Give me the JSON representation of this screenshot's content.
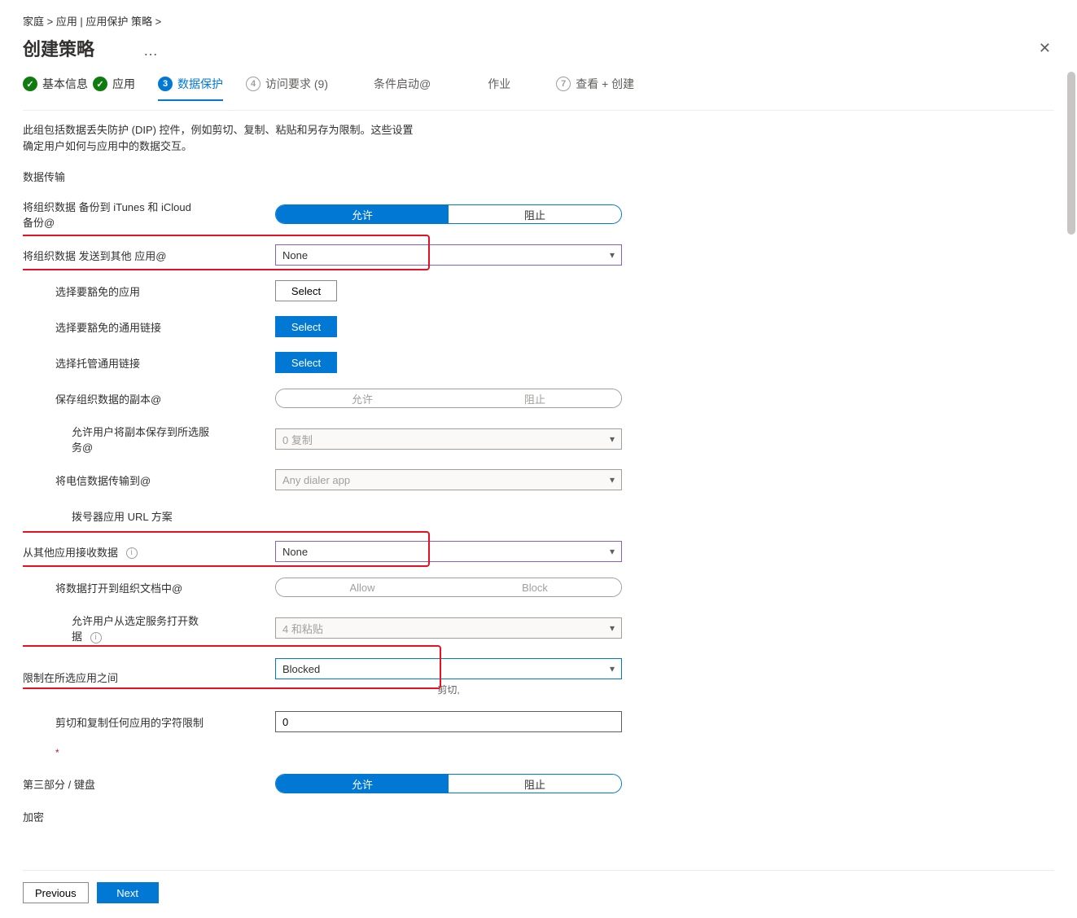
{
  "breadcrumb": "家庭 >   应用 | 应用保护 策略 >",
  "pageTitle": "创建策略",
  "ellipsis": "…",
  "steps": {
    "s1": "基本信息",
    "s2": "应用",
    "s3": "数据保护",
    "s4": "访问要求 (9)",
    "s4num": "4",
    "s5": "条件启动@",
    "s6": "作业",
    "s7": "查看 + 创建",
    "s7num": "7"
  },
  "desc": "此组包括数据丢失防护 (DIP) 控件，例如剪切、复制、粘贴和另存为限制。这些设置确定用户如何与应用中的数据交互。",
  "sectionDataTransfer": "数据传输",
  "labels": {
    "backupItunes": "将组织数据 备份到 iTunes 和 iCloud 备份@",
    "sendOrgData": "将组织数据 发送到其他 应用@",
    "selectExemptApps": "选择要豁免的应用",
    "selectExemptLinks": "选择要豁免的通用链接",
    "selectManagedLinks": "选择托管通用链接",
    "saveCopies": "保存组织数据的副本@",
    "allowSaveToServices": "允许用户将副本保存到所选服务@",
    "transferTelecom": "将电信数据传输到@",
    "dialerScheme": "拨号器应用 URL 方案",
    "receiveFromOther": "从其他应用接收数据",
    "openIntoOrgDocs": "将数据打开到组织文档中@",
    "allowOpenFromServices": "允许用户从选定服务打开数据",
    "restrictBetweenApps": "限制在所选应用之间",
    "cutCopyCharLimit": "剪切和复制任何应用的字符限制",
    "thirdPartyKeyboard": "第三部分 / 键盘",
    "encryption": "加密"
  },
  "values": {
    "allow": "允许",
    "block": "阻止",
    "allowEn": "Allow",
    "blockEn": "Block",
    "none": "None",
    "selectBtn": "Select",
    "zeroCopies": "0 复制",
    "anyDialer": "Any dialer app",
    "fourPaste": "4 和粘贴",
    "blocked": "Blocked",
    "cut": "剪切,",
    "zero": "0"
  },
  "footer": {
    "prev": "Previous",
    "next": "Next"
  }
}
